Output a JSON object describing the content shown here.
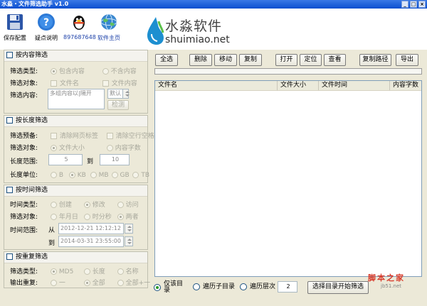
{
  "window": {
    "title": "水淼・文件筛选助手 v1.0",
    "min": "_",
    "max": "□",
    "close": "×"
  },
  "toolbar": {
    "save": "保存配置",
    "help": "疑点说明",
    "qq": "897687648",
    "home": "软件主页"
  },
  "logo": {
    "cn": "水淼软件",
    "url": "shuimiao.net"
  },
  "content_filter": {
    "title": "按内容筛选",
    "type_label": "筛选类型:",
    "type_opt1": "包含内容",
    "type_opt2": "不含内容",
    "obj_label": "筛选对象:",
    "obj_opt1": "文件名",
    "obj_opt2": "文件内容",
    "content_label": "筛选内容:",
    "content_placeholder": "多组内容以|隔开",
    "dropdown": "默认",
    "detect_btn": "检测"
  },
  "length_filter": {
    "title": "按长度筛选",
    "pre_label": "筛选预备:",
    "pre_opt1": "清除网页标签",
    "pre_opt2": "清除空行空格",
    "obj_label": "筛选对象:",
    "obj_opt1": "文件大小",
    "obj_opt2": "内容字数",
    "range_label": "长度范围:",
    "range_from": "5",
    "range_to_label": "到",
    "range_to": "10",
    "unit_label": "长度单位:",
    "units": [
      "B",
      "KB",
      "MB",
      "GB",
      "TB"
    ]
  },
  "time_filter": {
    "title": "按时间筛选",
    "type_label": "时间类型:",
    "type_opts": [
      "创建",
      "修改",
      "访问"
    ],
    "obj_label": "筛选对象:",
    "obj_opts": [
      "年月日",
      "时分秒",
      "两者"
    ],
    "range_label": "时间范围:",
    "from_label": "从",
    "from_value": "2012-12-21 12:12:12",
    "to_label": "到",
    "to_value": "2014-03-31 23:55:00"
  },
  "dup_filter": {
    "title": "按重复筛选",
    "type_label": "筛选类型:",
    "type_opts": [
      "MD5",
      "长度",
      "名称"
    ],
    "out_label": "输出重复:",
    "out_opts": [
      "一",
      "全部",
      "全部+一"
    ]
  },
  "actions": {
    "select_all": "全选",
    "delete": "删除",
    "move": "移动",
    "copy": "复制",
    "open": "打开",
    "locate": "定位",
    "view": "查看",
    "copy_path": "复制路径",
    "export": "导出"
  },
  "table": {
    "columns": [
      "文件名",
      "文件大小",
      "文件时间",
      "内容字数"
    ]
  },
  "scan": {
    "opt1": "仅该目录",
    "opt2": "遍历子目录",
    "opt3": "遍历层次",
    "depth": "2",
    "start_btn": "选择目录开始筛选"
  },
  "watermark": {
    "cn": "脚本之家",
    "en": "jb51.net"
  }
}
